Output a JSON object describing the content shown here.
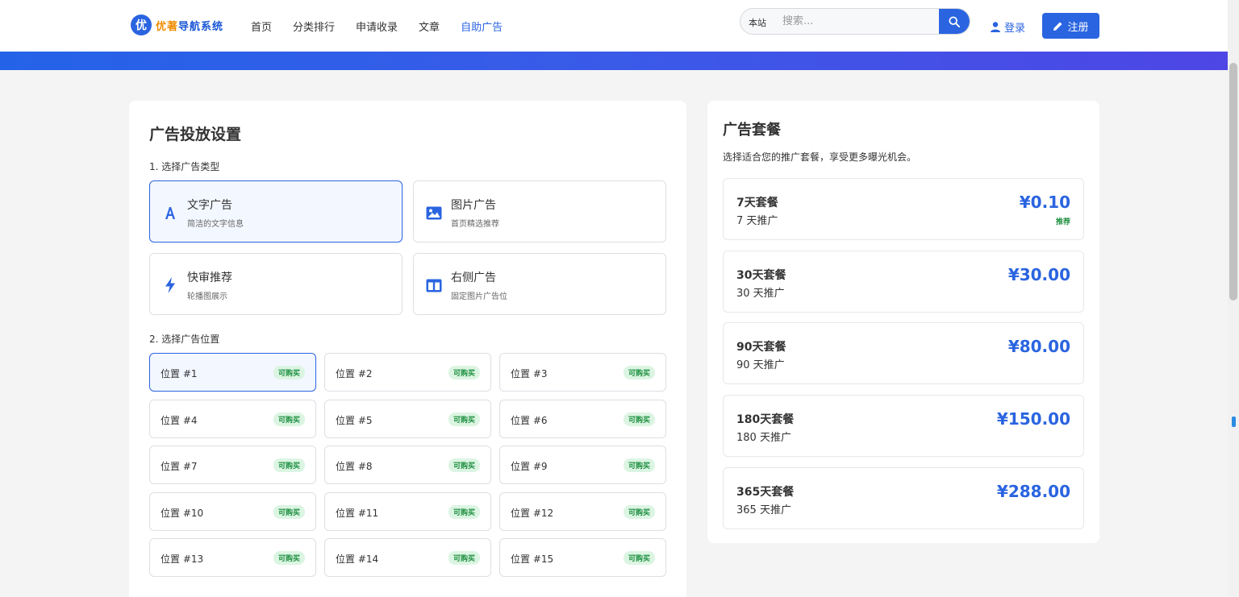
{
  "header": {
    "logo_badge": "优",
    "logo_part1": "优著",
    "logo_part2": "导航系统",
    "nav": [
      "首页",
      "分类排行",
      "申请收录",
      "文章",
      "自助广告"
    ],
    "active_nav": "自助广告",
    "search_scope": "本站",
    "search_placeholder": "搜索...",
    "login_label": "登录",
    "register_label": "注册"
  },
  "colors": {
    "accent": "#2a64e0",
    "available": "#1c8f3f",
    "banner_start": "#2463e8",
    "banner_end": "#4e46e5"
  },
  "ad_settings": {
    "title": "广告投放设置",
    "step1_label": "1. 选择广告类型",
    "types": [
      {
        "title": "文字广告",
        "desc": "简洁的文字信息",
        "icon": "font-icon",
        "selected": true
      },
      {
        "title": "图片广告",
        "desc": "首页精选推荐",
        "icon": "image-icon",
        "selected": false
      },
      {
        "title": "快审推荐",
        "desc": "轮播图展示",
        "icon": "bolt-icon",
        "selected": false
      },
      {
        "title": "右侧广告",
        "desc": "固定图片广告位",
        "icon": "columns-icon",
        "selected": false
      }
    ],
    "step2_label": "2. 选择广告位置",
    "positions": [
      {
        "name": "位置 #1",
        "status": "可购买",
        "selected": true
      },
      {
        "name": "位置 #2",
        "status": "可购买"
      },
      {
        "name": "位置 #3",
        "status": "可购买"
      },
      {
        "name": "位置 #4",
        "status": "可购买"
      },
      {
        "name": "位置 #5",
        "status": "可购买"
      },
      {
        "name": "位置 #6",
        "status": "可购买"
      },
      {
        "name": "位置 #7",
        "status": "可购买"
      },
      {
        "name": "位置 #8",
        "status": "可购买"
      },
      {
        "name": "位置 #9",
        "status": "可购买"
      },
      {
        "name": "位置 #10",
        "status": "可购买"
      },
      {
        "name": "位置 #11",
        "status": "可购买"
      },
      {
        "name": "位置 #12",
        "status": "可购买"
      },
      {
        "name": "位置 #13",
        "status": "可购买"
      },
      {
        "name": "位置 #14",
        "status": "可购买"
      },
      {
        "name": "位置 #15",
        "status": "可购买"
      }
    ]
  },
  "packages": {
    "title": "广告套餐",
    "desc": "选择适合您的推广套餐，享受更多曝光机会。",
    "items": [
      {
        "name": "7天套餐",
        "days": "7 天推广",
        "price": "¥0.10",
        "tag": "推荐"
      },
      {
        "name": "30天套餐",
        "days": "30 天推广",
        "price": "¥30.00"
      },
      {
        "name": "90天套餐",
        "days": "90 天推广",
        "price": "¥80.00"
      },
      {
        "name": "180天套餐",
        "days": "180 天推广",
        "price": "¥150.00"
      },
      {
        "name": "365天套餐",
        "days": "365 天推广",
        "price": "¥288.00"
      }
    ]
  }
}
